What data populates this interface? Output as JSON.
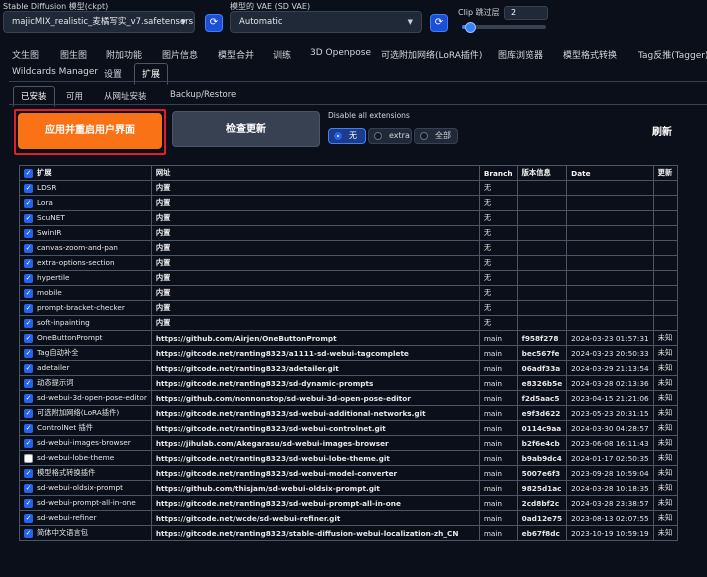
{
  "top": {
    "ckpt_label": "Stable Diffusion 模型(ckpt)",
    "ckpt_value": "majicMIX_realistic_麦橘写实_v7.safetensors [7c",
    "vae_label": "模型的 VAE (SD VAE)",
    "vae_value": "Automatic",
    "clip_label": "Clip 跳过层",
    "clip_value": "2",
    "clip_fraction": 0.083
  },
  "tabs_row1": [
    "文生图",
    "图生图",
    "附加功能",
    "图片信息",
    "模型合并",
    "训练",
    "3D Openpose",
    "可选附加网络(LoRA插件)",
    "图库浏览器",
    "模型格式转换",
    "Tag反推(Tagger)"
  ],
  "tabs_row2": [
    "Wildcards Manager",
    "设置",
    "扩展"
  ],
  "active_tab": "扩展",
  "subtabs": [
    "已安装",
    "可用",
    "从网址安装",
    "Backup/Restore"
  ],
  "active_subtab": "已安装",
  "actions": {
    "apply_label": "应用并重启用户界面",
    "check_label": "检查更新",
    "disable_label": "Disable all extensions",
    "options": [
      "无",
      "extra",
      "全部"
    ],
    "selected_option": "无",
    "refresh_label": "刷新",
    "accent": "#f97316"
  },
  "table": {
    "headers": [
      "扩展",
      "网址",
      "Branch",
      "版本信息",
      "Date",
      "更新"
    ],
    "rows": [
      {
        "checked": true,
        "name": "LDSR",
        "url": "内置",
        "branch": "无",
        "version": "",
        "date": "",
        "update": ""
      },
      {
        "checked": true,
        "name": "Lora",
        "url": "内置",
        "branch": "无",
        "version": "",
        "date": "",
        "update": ""
      },
      {
        "checked": true,
        "name": "ScuNET",
        "url": "内置",
        "branch": "无",
        "version": "",
        "date": "",
        "update": ""
      },
      {
        "checked": true,
        "name": "SwinIR",
        "url": "内置",
        "branch": "无",
        "version": "",
        "date": "",
        "update": ""
      },
      {
        "checked": true,
        "name": "canvas-zoom-and-pan",
        "url": "内置",
        "branch": "无",
        "version": "",
        "date": "",
        "update": ""
      },
      {
        "checked": true,
        "name": "extra-options-section",
        "url": "内置",
        "branch": "无",
        "version": "",
        "date": "",
        "update": ""
      },
      {
        "checked": true,
        "name": "hypertile",
        "url": "内置",
        "branch": "无",
        "version": "",
        "date": "",
        "update": ""
      },
      {
        "checked": true,
        "name": "mobile",
        "url": "内置",
        "branch": "无",
        "version": "",
        "date": "",
        "update": ""
      },
      {
        "checked": true,
        "name": "prompt-bracket-checker",
        "url": "内置",
        "branch": "无",
        "version": "",
        "date": "",
        "update": ""
      },
      {
        "checked": true,
        "name": "soft-inpainting",
        "url": "内置",
        "branch": "无",
        "version": "",
        "date": "",
        "update": ""
      },
      {
        "checked": true,
        "name": "OneButtonPrompt",
        "url": "https://github.com/Airjen/OneButtonPrompt",
        "branch": "main",
        "version": "f958f278",
        "date": "2024-03-23 01:57:31",
        "update": "未知"
      },
      {
        "checked": true,
        "name": "Tag自动补全",
        "url": "https://gitcode.net/ranting8323/a1111-sd-webui-tagcomplete",
        "branch": "main",
        "version": "bec567fe",
        "date": "2024-03-23 20:50:33",
        "update": "未知"
      },
      {
        "checked": true,
        "name": "adetailer",
        "url": "https://gitcode.net/ranting8323/adetailer.git",
        "branch": "main",
        "version": "06adf33a",
        "date": "2024-03-29 21:13:54",
        "update": "未知"
      },
      {
        "checked": true,
        "name": "动态提示词",
        "url": "https://gitcode.net/ranting8323/sd-dynamic-prompts",
        "branch": "main",
        "version": "e8326b5e",
        "date": "2024-03-28 02:13:36",
        "update": "未知"
      },
      {
        "checked": true,
        "name": "sd-webui-3d-open-pose-editor",
        "url": "https://github.com/nonnonstop/sd-webui-3d-open-pose-editor",
        "branch": "main",
        "version": "f2d5aac5",
        "date": "2023-04-15 21:21:06",
        "update": "未知"
      },
      {
        "checked": true,
        "name": "可选附加网络(LoRA插件)",
        "url": "https://gitcode.net/ranting8323/sd-webui-additional-networks.git",
        "branch": "main",
        "version": "e9f3d622",
        "date": "2023-05-23 20:31:15",
        "update": "未知"
      },
      {
        "checked": true,
        "name": "ControlNet 插件",
        "url": "https://gitcode.net/ranting8323/sd-webui-controlnet.git",
        "branch": "main",
        "version": "0114c9aa",
        "date": "2024-03-30 04:28:57",
        "update": "未知"
      },
      {
        "checked": true,
        "name": "sd-webui-images-browser",
        "url": "https://jihulab.com/Akegarasu/sd-webui-images-browser",
        "branch": "main",
        "version": "b2f6e4cb",
        "date": "2023-06-08 16:11:43",
        "update": "未知"
      },
      {
        "checked": false,
        "name": "sd-webui-lobe-theme",
        "url": "https://gitcode.net/ranting8323/sd-webui-lobe-theme.git",
        "branch": "main",
        "version": "b9ab9dc4",
        "date": "2024-01-17 02:50:35",
        "update": "未知"
      },
      {
        "checked": true,
        "name": "模型格式转换插件",
        "url": "https://gitcode.net/ranting8323/sd-webui-model-converter",
        "branch": "main",
        "version": "5007e6f3",
        "date": "2023-09-28 10:59:04",
        "update": "未知"
      },
      {
        "checked": true,
        "name": "sd-webui-oldsix-prompt",
        "url": "https://github.com/thisjam/sd-webui-oldsix-prompt.git",
        "branch": "main",
        "version": "9825d1ac",
        "date": "2024-03-28 10:18:35",
        "update": "未知"
      },
      {
        "checked": true,
        "name": "sd-webui-prompt-all-in-one",
        "url": "https://gitcode.net/ranting8323/sd-webui-prompt-all-in-one",
        "branch": "main",
        "version": "2cd8bf2c",
        "date": "2024-03-28 23:38:57",
        "update": "未知"
      },
      {
        "checked": true,
        "name": "sd-webui-refiner",
        "url": "https://gitcode.net/wcde/sd-webui-refiner.git",
        "branch": "main",
        "version": "0ad12e75",
        "date": "2023-08-13 02:07:55",
        "update": "未知"
      },
      {
        "checked": true,
        "name": "简体中文语言包",
        "url": "https://gitcode.net/ranting8323/stable-diffusion-webui-localization-zh_CN",
        "branch": "main",
        "version": "eb67f8dc",
        "date": "2023-10-19 10:59:19",
        "update": "未知"
      }
    ]
  }
}
